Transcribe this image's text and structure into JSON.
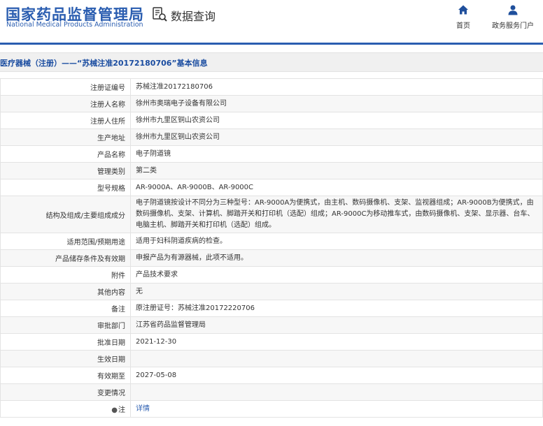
{
  "header": {
    "logo_cn": "国家药品监督管理局",
    "logo_en": "National Medical Products Administration",
    "query_label": "数据查询",
    "nav": [
      {
        "label": "首页",
        "icon": "home-icon"
      },
      {
        "label": "政务服务门户",
        "icon": "user-icon"
      }
    ]
  },
  "colors": {
    "brand": "#2a5db0",
    "title": "#1a4ca0"
  },
  "title": "医疗器械（注册）——“苏械注准20172180706”基本信息",
  "fields": [
    {
      "key": "注册证编号",
      "value": "苏械注准20172180706"
    },
    {
      "key": "注册人名称",
      "value": "徐州市奥瑞电子设备有限公司"
    },
    {
      "key": "注册人住所",
      "value": "徐州市九里区铜山农资公司"
    },
    {
      "key": "生产地址",
      "value": "徐州市九里区铜山农资公司"
    },
    {
      "key": "产品名称",
      "value": "电子阴道镜"
    },
    {
      "key": "管理类别",
      "value": "第二类"
    },
    {
      "key": "型号规格",
      "value": "AR-9000A、AR-9000B、AR-9000C"
    },
    {
      "key": "结构及组成/主要组成成分",
      "value": "电子阴道镜按设计不同分为三种型号：AR-9000A为便携式，由主机、数码摄像机、支架、监视器组成；AR-9000B为便携式，由数码摄像机、支架、计算机、脚踏开关和打印机（选配）组成；AR-9000C为移动推车式，由数码摄像机、支架、显示器、台车、电脑主机、脚踏开关和打印机（选配）组成。"
    },
    {
      "key": "适用范围/预期用途",
      "value": "适用于妇科阴道疾病的检查。"
    },
    {
      "key": "产品储存条件及有效期",
      "value": "申报产品为有源器械，此项不适用。"
    },
    {
      "key": "附件",
      "value": "产品技术要求"
    },
    {
      "key": "其他内容",
      "value": "无"
    },
    {
      "key": "备注",
      "value": "原注册证号：苏械注准20172220706"
    },
    {
      "key": "审批部门",
      "value": "江苏省药品监督管理局"
    },
    {
      "key": "批准日期",
      "value": "2021-12-30"
    },
    {
      "key": "生效日期",
      "value": ""
    },
    {
      "key": "有效期至",
      "value": "2027-05-08"
    },
    {
      "key": "变更情况",
      "value": ""
    }
  ],
  "note": {
    "key": "注",
    "value": "详情"
  }
}
